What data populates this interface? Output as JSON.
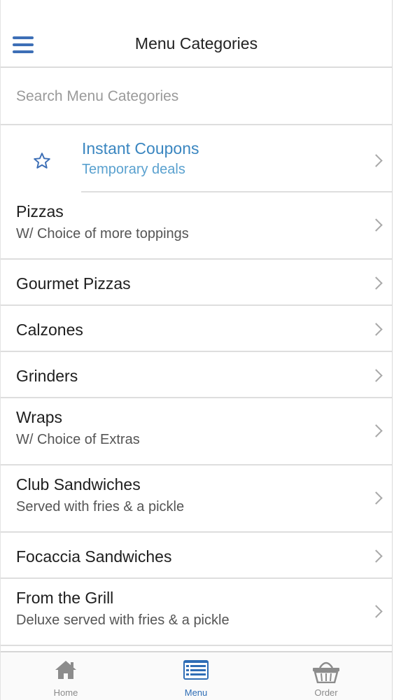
{
  "header": {
    "title": "Menu Categories",
    "menu_icon": "hamburger-icon"
  },
  "search": {
    "placeholder": "Search Menu Categories",
    "value": ""
  },
  "coupon": {
    "icon": "star-icon",
    "title": "Instant Coupons",
    "subtitle": "Temporary deals"
  },
  "categories": [
    {
      "title": "Pizzas",
      "subtitle": "W/ Choice of more toppings"
    },
    {
      "title": "Gourmet Pizzas"
    },
    {
      "title": "Calzones"
    },
    {
      "title": "Grinders"
    },
    {
      "title": "Wraps",
      "subtitle": "W/ Choice of Extras"
    },
    {
      "title": "Club Sandwiches",
      "subtitle": "Served with fries & a pickle"
    },
    {
      "title": "Focaccia Sandwiches"
    },
    {
      "title": "From the Grill",
      "subtitle": "Deluxe served with fries & a pickle"
    }
  ],
  "tabs": [
    {
      "label": "Home",
      "icon": "home-icon"
    },
    {
      "label": "Menu",
      "icon": "menu-list-icon",
      "active": true
    },
    {
      "label": "Order",
      "icon": "basket-icon"
    }
  ],
  "colors": {
    "accent": "#3d6fb6",
    "coupon_title": "#3a86c0",
    "coupon_subtitle": "#5aa1cf",
    "tab_inactive": "#8a8a8a"
  }
}
